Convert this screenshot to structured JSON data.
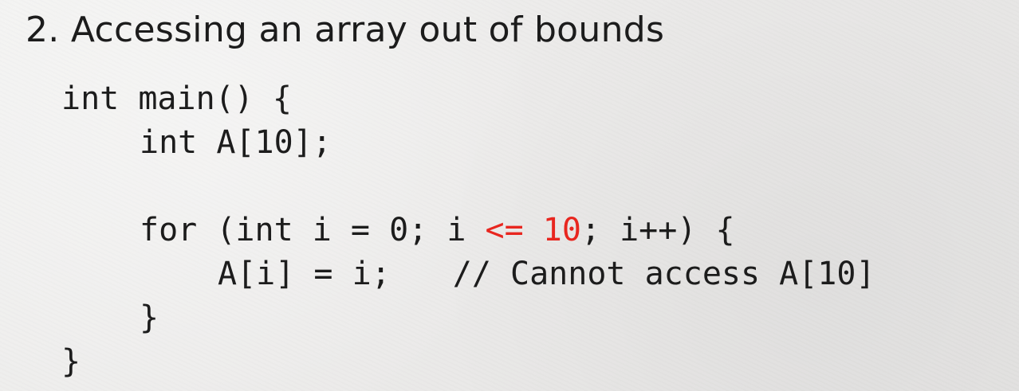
{
  "slide": {
    "title": "2. Accessing an array out of bounds"
  },
  "colors": {
    "text": "#1c1c1c",
    "highlight": "#e8261f",
    "background": "#ecebea"
  },
  "code": {
    "line1": "int main() {",
    "line2": "int A[10];",
    "line4_prefix": "for (int i = 0; i ",
    "line4_highlight": "<= 10",
    "line4_suffix": "; i++) {",
    "line5_statement": "A[i] = i;",
    "line5_comment": "// Cannot access A[10]",
    "line6": "}",
    "line7": "}"
  }
}
